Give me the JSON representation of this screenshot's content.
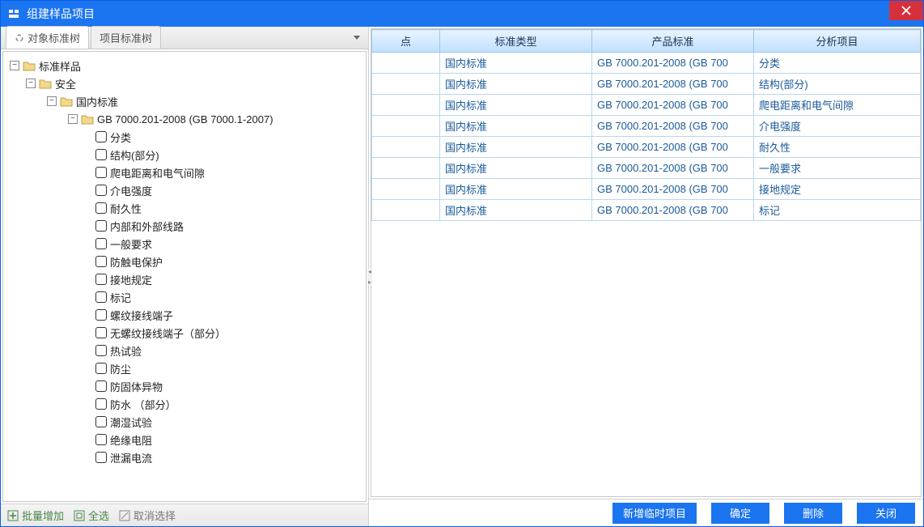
{
  "window": {
    "title": "组建样品项目"
  },
  "tabs": {
    "active": "对象标准树",
    "inactive": "项目标准树"
  },
  "tree": {
    "root": "标准样品",
    "level1": "安全",
    "level2": "国内标准",
    "level3": "GB 7000.201-2008 (GB 7000.1-2007)",
    "leaves": [
      "分类",
      "结构(部分)",
      "爬电距离和电气间隙",
      "介电强度",
      "耐久性",
      "内部和外部线路",
      "一般要求",
      "防触电保护",
      "接地规定",
      "标记",
      "螺纹接线端子",
      "无螺纹接线端子（部分）",
      "热试验",
      "防尘",
      "防固体异物",
      "防水 （部分）",
      "潮湿试验",
      "绝缘电阻",
      "泄漏电流"
    ]
  },
  "left_toolbar": {
    "batch_add": "批量增加",
    "select_all": "全选",
    "deselect": "取消选择"
  },
  "grid": {
    "headers": {
      "c1": "点",
      "c2": "标准类型",
      "c3": "产品标准",
      "c4": "分析项目"
    },
    "rows": [
      {
        "type": "国内标准",
        "std": "GB 7000.201-2008 (GB 700",
        "item": "分类"
      },
      {
        "type": "国内标准",
        "std": "GB 7000.201-2008 (GB 700",
        "item": "结构(部分)"
      },
      {
        "type": "国内标准",
        "std": "GB 7000.201-2008 (GB 700",
        "item": "爬电距离和电气间隙"
      },
      {
        "type": "国内标准",
        "std": "GB 7000.201-2008 (GB 700",
        "item": "介电强度"
      },
      {
        "type": "国内标准",
        "std": "GB 7000.201-2008 (GB 700",
        "item": "耐久性"
      },
      {
        "type": "国内标准",
        "std": "GB 7000.201-2008 (GB 700",
        "item": "一般要求"
      },
      {
        "type": "国内标准",
        "std": "GB 7000.201-2008 (GB 700",
        "item": "接地规定"
      },
      {
        "type": "国内标准",
        "std": "GB 7000.201-2008 (GB 700",
        "item": "标记"
      }
    ]
  },
  "buttons": {
    "add_temp": "新增临时项目",
    "ok": "确定",
    "delete": "删除",
    "close": "关闭"
  }
}
